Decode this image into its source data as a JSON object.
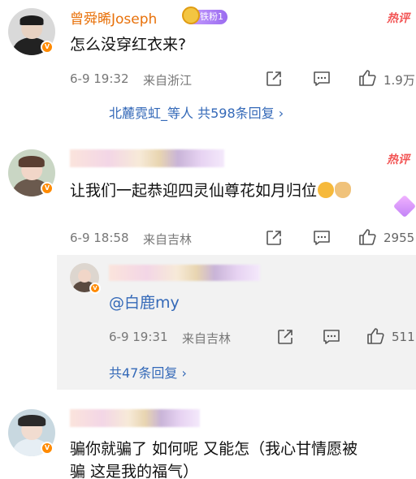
{
  "comments": [
    {
      "name": "曾舜晞Joseph",
      "badge": "铁粉1",
      "hot": "热评",
      "text": "怎么没穿红衣来?",
      "time": "6-9 19:32",
      "location": "来自浙江",
      "likes": "1.9万",
      "replies_link": "北麓霓虹_等人 共598条回复 ›"
    },
    {
      "hot": "热评",
      "text": "让我们一起恭迎四灵仙尊花如月归位",
      "time": "6-9 18:58",
      "location": "来自吉林",
      "likes": "2955",
      "reply": {
        "text": "@白鹿my",
        "time": "6-9 19:31",
        "location": "来自吉林",
        "likes": "511"
      },
      "replies_link": "共47条回复 ›"
    },
    {
      "text_line1": "骗你就骗了 如何呢 又能怎（我心甘情愿被",
      "text_line2": "骗 这是我的福气）"
    }
  ],
  "colors": {
    "name": "#e8710a",
    "hot": "#f25555",
    "link": "#3469b8",
    "meta": "#777777"
  },
  "icons": [
    "share-icon",
    "comment-icon",
    "like-icon",
    "v-badge-icon",
    "fan-medal-icon",
    "heart-sticker-icon"
  ]
}
